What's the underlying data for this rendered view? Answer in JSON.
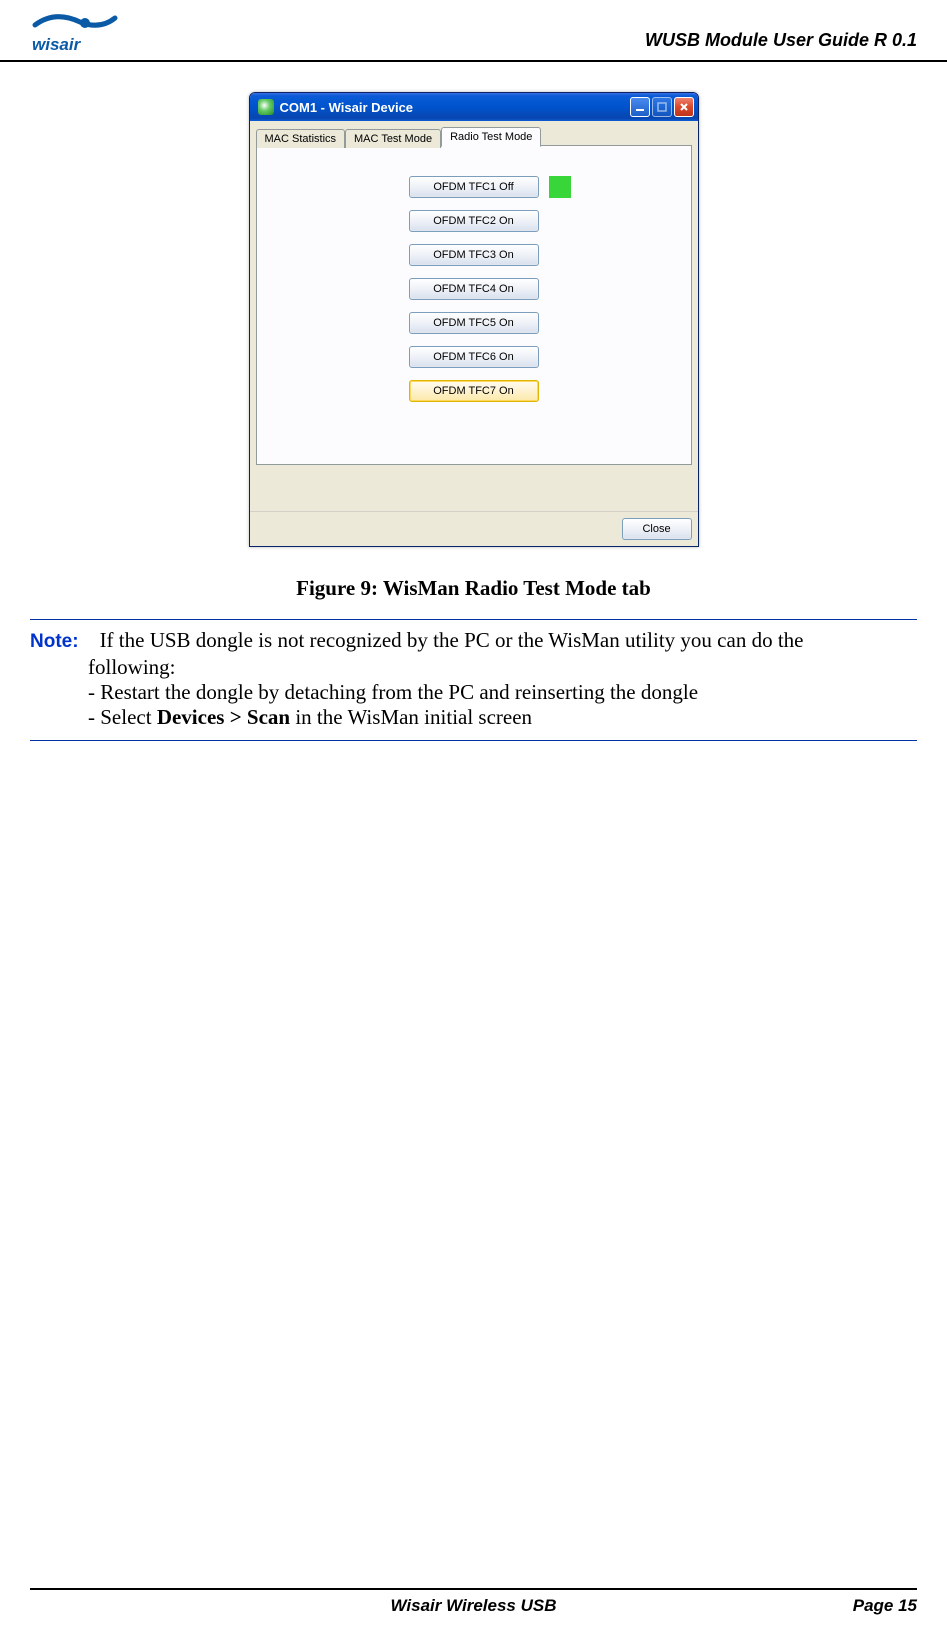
{
  "header": {
    "logoText": "wisair",
    "title": "WUSB Module User Guide R 0.1"
  },
  "window": {
    "title": "COM1 - Wisair Device",
    "tabs": {
      "tab1": "MAC Statistics",
      "tab2": "MAC Test Mode",
      "tab3": "Radio Test Mode"
    },
    "buttons": {
      "b1": "OFDM TFC1 Off",
      "b2": "OFDM TFC2  On",
      "b3": "OFDM TFC3  On",
      "b4": "OFDM TFC4 On",
      "b5": "OFDM TFC5 On",
      "b6": "OFDM TFC6 On",
      "b7": "OFDM TFC7 On"
    },
    "close": "Close"
  },
  "caption": "Figure 9: WisMan Radio Test Mode tab",
  "note": {
    "label": "Note:",
    "line1": "If the USB dongle is not recognized by the PC or the WisMan utility you can do the",
    "line2": "following:",
    "line3": "- Restart the dongle by detaching from the PC and reinserting the dongle",
    "line4a": "- Select ",
    "line4b": "Devices > Scan",
    "line4c": " in the WisMan initial screen"
  },
  "footer": {
    "center": "Wisair Wireless USB",
    "right": "Page 15"
  }
}
